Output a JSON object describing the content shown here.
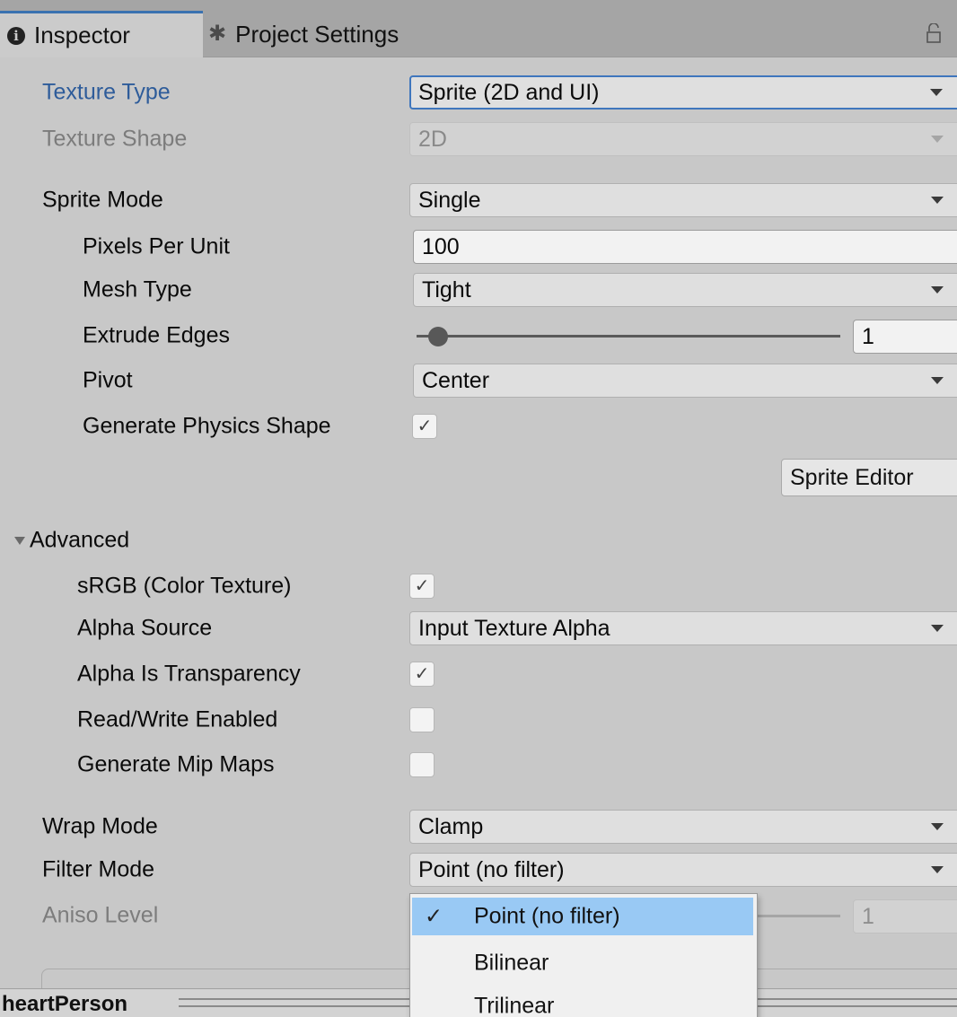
{
  "tabs": [
    {
      "label": "Inspector",
      "icon": "info-icon",
      "active": true
    },
    {
      "label": "Project Settings",
      "icon": "gear-icon",
      "active": false
    }
  ],
  "accent_color": "#3f76bd",
  "fields": {
    "texture_type": {
      "label": "Texture Type",
      "value": "Sprite (2D and UI)"
    },
    "texture_shape": {
      "label": "Texture Shape",
      "value": "2D"
    },
    "sprite_mode": {
      "label": "Sprite Mode",
      "value": "Single"
    },
    "pixels_per_unit": {
      "label": "Pixels Per Unit",
      "value": "100"
    },
    "mesh_type": {
      "label": "Mesh Type",
      "value": "Tight"
    },
    "extrude_edges": {
      "label": "Extrude Edges",
      "value": "1",
      "slider_fraction": 0.05
    },
    "pivot": {
      "label": "Pivot",
      "value": "Center"
    },
    "generate_physics_shape": {
      "label": "Generate Physics Shape",
      "checked": true
    },
    "sprite_editor_button": "Sprite Editor"
  },
  "advanced": {
    "label": "Advanced",
    "expanded": true,
    "srgb": {
      "label": "sRGB (Color Texture)",
      "checked": true
    },
    "alpha_source": {
      "label": "Alpha Source",
      "value": "Input Texture Alpha"
    },
    "alpha_is_transparency": {
      "label": "Alpha Is Transparency",
      "checked": true
    },
    "read_write": {
      "label": "Read/Write Enabled",
      "checked": false
    },
    "mip_maps": {
      "label": "Generate Mip Maps",
      "checked": false
    }
  },
  "wrap_mode": {
    "label": "Wrap Mode",
    "value": "Clamp"
  },
  "filter_mode": {
    "label": "Filter Mode",
    "value": "Point (no filter)",
    "options": [
      "Point (no filter)",
      "Bilinear",
      "Trilinear"
    ],
    "selected_index": 0
  },
  "aniso_level": {
    "label": "Aniso Level",
    "value": "1"
  },
  "asset_name": "heartPerson"
}
